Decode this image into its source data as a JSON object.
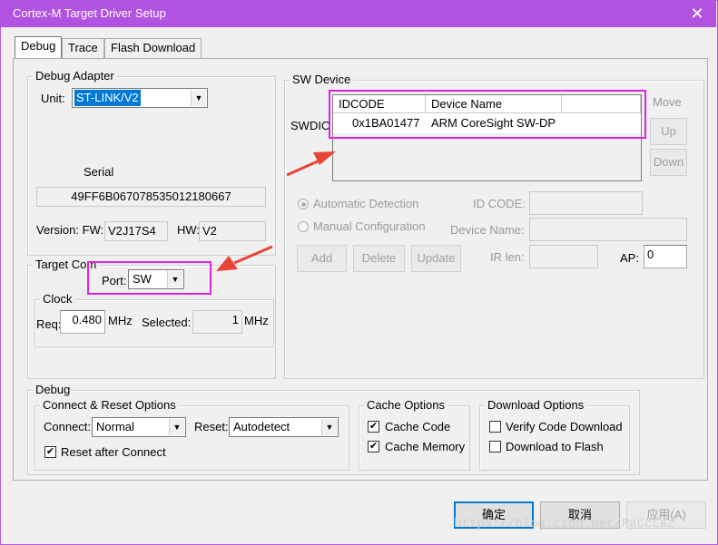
{
  "window": {
    "title": "Cortex-M Target Driver Setup",
    "close_glyph": "✕"
  },
  "tabs": [
    {
      "label": "Debug"
    },
    {
      "label": "Trace"
    },
    {
      "label": "Flash Download"
    }
  ],
  "debug_adapter": {
    "legend": "Debug Adapter",
    "unit_label": "Unit:",
    "unit_value": "ST-LINK/V2",
    "serial_label": "Serial",
    "serial_value": "49FF6B067078535012180667",
    "fw_label": "Version: FW:",
    "fw_value": "V2J17S4",
    "hw_label": "HW:",
    "hw_value": "V2"
  },
  "target_com": {
    "legend": "Target Com",
    "port_label": "Port:",
    "port_value": "SW",
    "clock": {
      "legend": "Clock",
      "req_label": "Req:",
      "req_value": "0.480",
      "req_unit": "MHz",
      "selected_label": "Selected:",
      "selected_value": "1",
      "selected_unit": "MHz"
    }
  },
  "sw_device": {
    "legend": "SW Device",
    "row_label": "SWDIO",
    "columns": [
      "IDCODE",
      "Device Name"
    ],
    "rows": [
      {
        "idcode": "0x1BA01477",
        "name": "ARM CoreSight SW-DP"
      }
    ],
    "move_label": "Move",
    "up_label": "Up",
    "down_label": "Down",
    "auto_detect_label": "Automatic Detection",
    "manual_config_label": "Manual Configuration",
    "id_code_label": "ID CODE:",
    "device_name_label": "Device Name:",
    "ir_len_label": "IR len:",
    "ap_label": "AP:",
    "ap_value": "0",
    "add_label": "Add",
    "delete_label": "Delete",
    "update_label": "Update"
  },
  "debug": {
    "legend": "Debug",
    "connect_reset": {
      "legend": "Connect & Reset Options",
      "connect_label": "Connect:",
      "connect_value": "Normal",
      "reset_label": "Reset:",
      "reset_value": "Autodetect",
      "reset_after_connect_label": "Reset after Connect",
      "reset_after_connect_checked": true
    },
    "cache_options": {
      "legend": "Cache Options",
      "cache_code_label": "Cache Code",
      "cache_code_checked": true,
      "cache_memory_label": "Cache Memory",
      "cache_memory_checked": true
    },
    "download_options": {
      "legend": "Download Options",
      "verify_label": "Verify Code Download",
      "verify_checked": false,
      "download_flash_label": "Download to Flash",
      "download_flash_checked": false
    }
  },
  "footer": {
    "ok_label": "确定",
    "cancel_label": "取消",
    "apply_label": "应用(A)"
  },
  "watermark": "https://blog.csdn.net/RaCcLaz",
  "colors": {
    "titlebar": "#b252e1",
    "highlight": "#e022e0",
    "arrow": "#e8443a",
    "selection": "#0078d7"
  }
}
